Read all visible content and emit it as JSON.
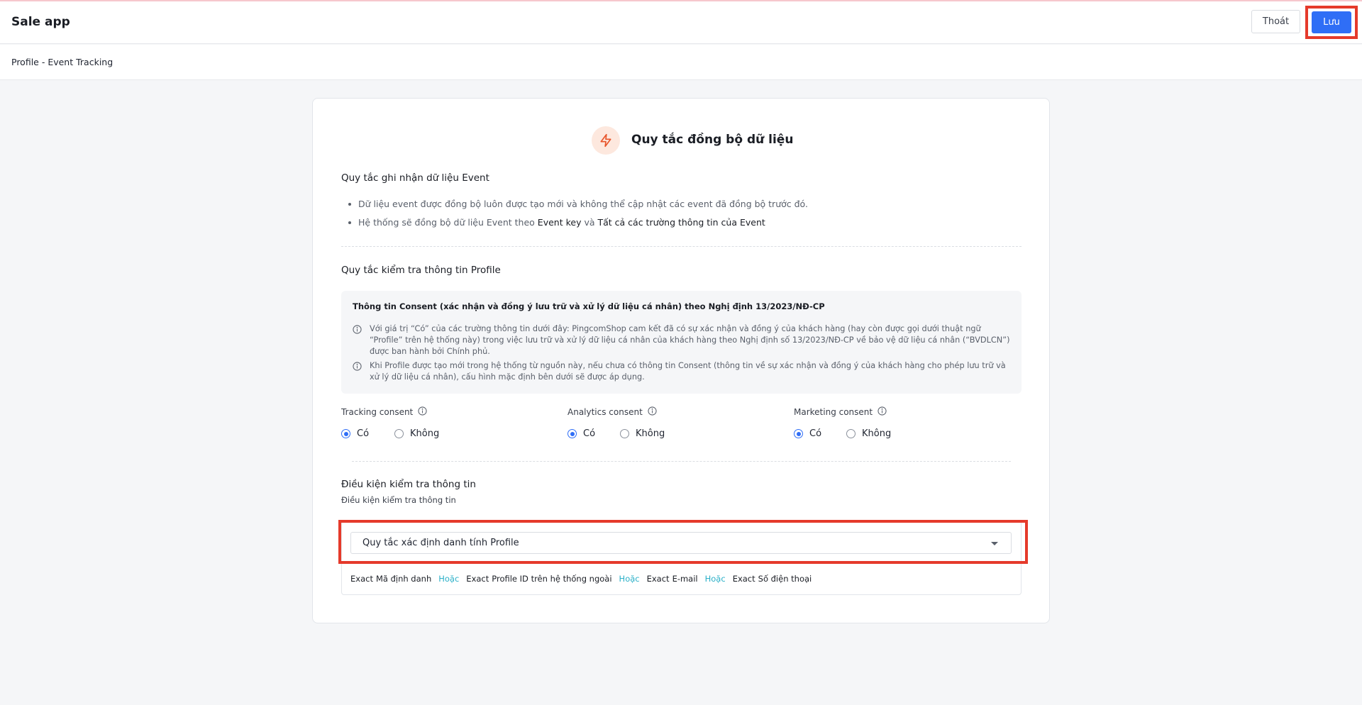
{
  "app": {
    "title": "Sale app",
    "exit_label": "Thoát",
    "save_label": "Lưu"
  },
  "breadcrumb": "Profile - Event Tracking",
  "card": {
    "title": "Quy tắc đồng bộ dữ liệu",
    "event_section": {
      "title": "Quy tắc ghi nhận dữ liệu Event",
      "bullet1": "Dữ liệu event được đồng bộ luôn được tạo mới và không thể cập nhật các event đã đồng bộ trước đó.",
      "bullet2_prefix": "Hệ thống sẽ đồng bộ dữ liệu Event theo ",
      "bullet2_key": "Event key",
      "bullet2_and": " và ",
      "bullet2_fields": "Tất cả các trường thông tin của Event"
    },
    "profile_section": {
      "title": "Quy tắc kiểm tra thông tin Profile",
      "consent_title": "Thông tin Consent (xác nhận và đồng ý lưu trữ và xử lý dữ liệu cá nhân) theo Nghị định 13/2023/NĐ-CP",
      "note1": "Với giá trị “Có” của các trường thông tin dưới đây: PingcomShop cam kết đã có sự xác nhận và đồng ý của khách hàng (hay còn được gọi dưới thuật ngữ “Profile” trên hệ thống này) trong việc lưu trữ và xử lý dữ liệu cá nhân của khách hàng theo Nghị định số 13/2023/NĐ-CP về bảo vệ dữ liệu cá nhân (“BVDLCN”) được ban hành bởi Chính phủ.",
      "note2": "Khi Profile được tạo mới trong hệ thống từ nguồn này, nếu chưa có thông tin Consent (thông tin về sự xác nhận và đồng ý của khách hàng cho phép lưu trữ và xử lý dữ liệu cá nhân), cấu hình mặc định bên dưới sẽ được áp dụng."
    },
    "consents": [
      {
        "label": "Tracking consent",
        "yes": "Có",
        "no": "Không",
        "selected": "Có"
      },
      {
        "label": "Analytics consent",
        "yes": "Có",
        "no": "Không",
        "selected": "Có"
      },
      {
        "label": "Marketing consent",
        "yes": "Có",
        "no": "Không",
        "selected": "Có"
      }
    ],
    "condition": {
      "title": "Điều kiện kiểm tra thông tin",
      "subtitle": "Điều kiện kiểm tra thông tin",
      "select_value": "Quy tắc xác định danh tính Profile",
      "rule": {
        "exact": "Exact",
        "or": "Hoặc",
        "fields": [
          "Mã định danh",
          "Profile ID trên hệ thống ngoài",
          "E-mail",
          "Số điện thoại"
        ]
      }
    }
  },
  "colors": {
    "primary": "#2f6ef6",
    "highlight": "#e53a2b",
    "or_text": "#2bb0c8",
    "icon_bg": "#fde8de",
    "icon_stroke": "#e8542a"
  }
}
